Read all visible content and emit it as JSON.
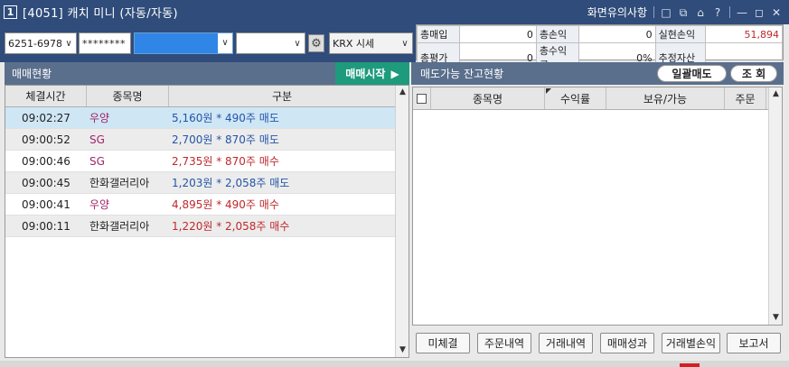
{
  "window": {
    "number": "1",
    "title": "[4051] 캐치 미니 (자동/자동)",
    "caution_label": "화면유의사항",
    "controls": [
      "□",
      "⧉",
      "⌂",
      "?",
      "—",
      "◻",
      "✕"
    ]
  },
  "controls": {
    "account": "6251-6978",
    "password": "********",
    "selected_blue": "",
    "select_empty": "",
    "market": "KRX 시세"
  },
  "summary": {
    "row1": [
      {
        "label": "총매입",
        "value": "0"
      },
      {
        "label": "총손익",
        "value": "0"
      },
      {
        "label": "실현손익",
        "value": "51,894",
        "color": "#c0282b"
      }
    ],
    "row2": [
      {
        "label": "총평가",
        "value": "0"
      },
      {
        "label": "총수익률",
        "value": "0%"
      },
      {
        "label": "추정자산",
        "value": ""
      }
    ]
  },
  "left_panel": {
    "title": "매매현황",
    "start_button": "매매시작",
    "columns": [
      "체결시간",
      "종목명",
      "구분"
    ],
    "rows": [
      {
        "time": "09:02:27",
        "name": "우양",
        "desc": "5,160원 * 490주 매도",
        "side": "sell"
      },
      {
        "time": "09:00:52",
        "name": "SG",
        "desc": "2,700원 * 870주 매도",
        "side": "sell"
      },
      {
        "time": "09:00:46",
        "name": "SG",
        "desc": "2,735원 * 870주 매수",
        "side": "buy"
      },
      {
        "time": "09:00:45",
        "name": "한화갤러리아",
        "desc": "1,203원 * 2,058주 매도",
        "side": "sell"
      },
      {
        "time": "09:00:41",
        "name": "우양",
        "desc": "4,895원 * 490주 매수",
        "side": "buy"
      },
      {
        "time": "09:00:11",
        "name": "한화갤러리아",
        "desc": "1,220원 * 2,058주 매수",
        "side": "buy"
      }
    ]
  },
  "right_panel": {
    "title": "매도가능 잔고현황",
    "bulk_sell": "일괄매도",
    "inquiry": "조 회",
    "columns": [
      "종목명",
      "수익률",
      "보유/가능",
      "주문"
    ]
  },
  "bottom_buttons": [
    "미체결",
    "주문내역",
    "거래내역",
    "매매성과",
    "거래별손익",
    "보고서"
  ]
}
